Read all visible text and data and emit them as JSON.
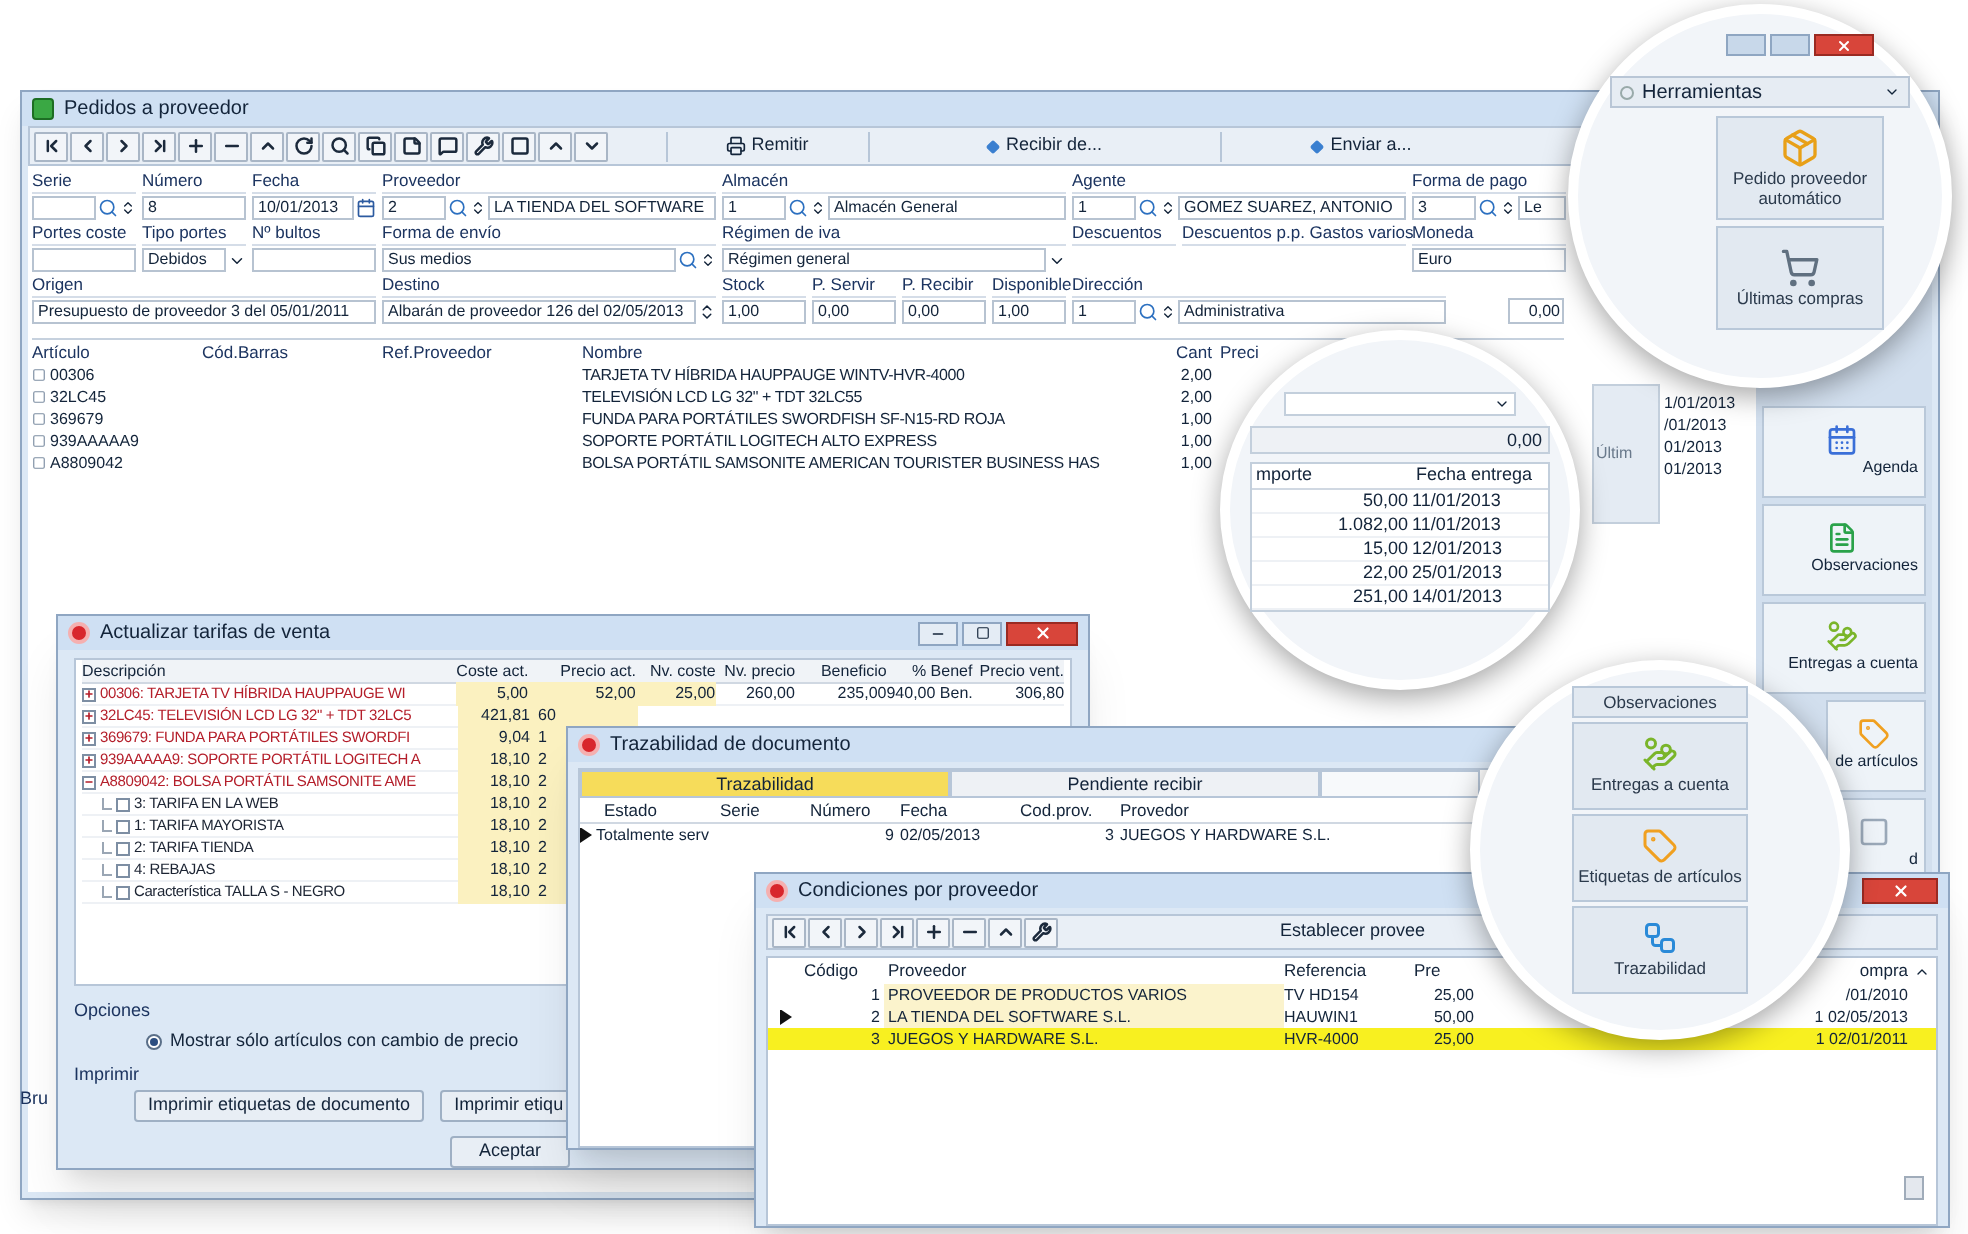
{
  "main_window": {
    "title": "Pedidos a proveedor",
    "actions": [
      {
        "label": "Remitir",
        "kind": "print"
      },
      {
        "label": "Recibir de...",
        "kind": "dropdown"
      },
      {
        "label": "Enviar a...",
        "kind": "dropdown"
      }
    ],
    "form_rows": [
      [
        {
          "label": "Serie",
          "kind": "lookup"
        },
        {
          "label": "Número",
          "value": "8",
          "kind": "text"
        },
        {
          "label": "Fecha",
          "value": "10/01/2013",
          "kind": "date"
        },
        {
          "label": "Proveedor",
          "value": "2",
          "detail": "LA TIENDA DEL SOFTWARE",
          "kind": "lookup"
        },
        {
          "label": "Almacén",
          "value": "1",
          "detail": "Almacén General",
          "kind": "lookup"
        },
        {
          "label": "Agente",
          "value": "1",
          "detail": "GOMEZ SUAREZ, ANTONIO",
          "kind": "lookup"
        },
        {
          "label": "Forma de pago",
          "value": "3",
          "detail": "Le",
          "kind": "lookup"
        }
      ],
      [
        {
          "label": "Portes coste",
          "kind": "text"
        },
        {
          "label": "Tipo portes",
          "value": "Debidos",
          "kind": "select"
        },
        {
          "label": "Nº bultos",
          "kind": "text"
        },
        {
          "label": "Forma de envío",
          "value": "Sus medios",
          "kind": "lookup"
        },
        {
          "label": "Régimen de iva",
          "value": "Régimen general",
          "kind": "select"
        },
        {
          "label": "Descuentos",
          "kind": "label"
        },
        {
          "label": "Descuentos p.p. Gastos varios",
          "kind": "label"
        },
        {
          "label": "Moneda",
          "value": "Euro",
          "kind": "text"
        }
      ],
      [
        {
          "label": "Origen",
          "value": "Presupuesto de proveedor 3 del 05/01/2011",
          "kind": "text"
        },
        {
          "label": "Destino",
          "value": "Albarán de proveedor 126 del 02/05/2013",
          "kind": "spin"
        },
        {
          "label": "Stock",
          "value": "1,00",
          "kind": "text"
        },
        {
          "label": "P. Servir",
          "value": "0,00",
          "kind": "text"
        },
        {
          "label": "P. Recibir",
          "value": "0,00",
          "kind": "text"
        },
        {
          "label": "Disponible",
          "value": "1,00",
          "kind": "text"
        },
        {
          "label": "Dirección",
          "value": "1",
          "detail": "Administrativa",
          "kind": "lookup"
        }
      ]
    ],
    "lines": {
      "columns": [
        "Artículo",
        "Cód.Barras",
        "Ref.Proveedor",
        "Nombre",
        "Cant",
        "Preci"
      ],
      "rows": [
        {
          "code": "00306",
          "name": "TARJETA TV HÍBRIDA HAUPPAUGE WINTV-HVR-4000",
          "qty": "2,00"
        },
        {
          "code": "32LC45",
          "name": "TELEVISIÓN LCD LG 32\" + TDT 32LC55",
          "qty": "2,00"
        },
        {
          "code": "369679",
          "name": "FUNDA PARA PORTÁTILES SWORDFISH SF-N15-RD ROJA",
          "qty": "1,00"
        },
        {
          "code": "939AAAAA9",
          "name": "SOPORTE PORTÁTIL LOGITECH ALTO EXPRESS",
          "qty": "1,00"
        },
        {
          "code": "A8809042",
          "name": "BOLSA PORTÁTIL SAMSONITE AMERICAN TOURISTER BUSINESS HAS",
          "qty": "1,00"
        }
      ]
    },
    "total": "0,00",
    "side_panel": {
      "button": "Últim",
      "dates": [
        "1/01/2013",
        "/01/2013",
        "01/2013",
        "01/2013"
      ]
    },
    "sidebar": [
      "Agenda",
      "Observaciones",
      "Entregas a cuenta",
      "de artículos",
      "d"
    ],
    "status_label": "Bru"
  },
  "magnifier_tools": {
    "dropdown": "Herramientas",
    "buttons": [
      "Pedido proveedor automático",
      "Últimas compras"
    ]
  },
  "magnifier_deliveries": {
    "total": "0,00",
    "columns": [
      "mporte",
      "Fecha entrega"
    ],
    "rows": [
      {
        "amount": "50,00",
        "date": "11/01/2013"
      },
      {
        "amount": "1.082,00",
        "date": "11/01/2013"
      },
      {
        "amount": "15,00",
        "date": "12/01/2013"
      },
      {
        "amount": "22,00",
        "date": "25/01/2013"
      },
      {
        "amount": "251,00",
        "date": "14/01/2013"
      }
    ]
  },
  "magnifier_sidebar": {
    "buttons": [
      "Observaciones",
      "Entregas a cuenta",
      "Etiquetas de artículos",
      "Trazabilidad"
    ]
  },
  "tariffs_dialog": {
    "title": "Actualizar tarifas de venta",
    "columns": [
      "Descripción",
      "Coste act.",
      "Precio act.",
      "Nv. coste",
      "Nv. precio",
      "Beneficio",
      "% Benef",
      "Precio vent."
    ],
    "rows": [
      {
        "desc": "00306: TARJETA TV HÍBRIDA HAUPPAUGE WI",
        "coste": "5,00",
        "precio": "52,00",
        "nv_coste": "25,00",
        "nv_precio": "260,00",
        "beneficio": "235,00",
        "pct": "940,00 Ben.",
        "venta": "306,80",
        "expanded": false
      },
      {
        "desc": "32LC45: TELEVISIÓN LCD LG 32\" + TDT 32LC5",
        "coste": "421,81",
        "precio": "60",
        "expanded": false
      },
      {
        "desc": "369679: FUNDA PARA PORTÁTILES SWORDFI",
        "coste": "9,04",
        "precio": "1",
        "expanded": false
      },
      {
        "desc": "939AAAAA9: SOPORTE PORTÁTIL LOGITECH A",
        "coste": "18,10",
        "precio": "2",
        "expanded": false
      },
      {
        "desc": "A8809042: BOLSA PORTÁTIL SAMSONITE AME",
        "coste": "18,10",
        "precio": "2",
        "expanded": true,
        "children": [
          {
            "desc": "3: TARIFA EN LA WEB",
            "coste": "18,10",
            "precio": "2",
            "checked": false
          },
          {
            "desc": "1: TARIFA MAYORISTA",
            "coste": "18,10",
            "precio": "2",
            "checked": false
          },
          {
            "desc": "2: TARIFA TIENDA",
            "coste": "18,10",
            "precio": "2",
            "checked": false
          },
          {
            "desc": "4: REBAJAS",
            "coste": "18,10",
            "precio": "2",
            "checked": false
          },
          {
            "desc": "Característica TALLA S - NEGRO",
            "coste": "18,10",
            "precio": "2",
            "checked": false
          }
        ]
      }
    ],
    "options_label": "Opciones",
    "option": {
      "label": "Mostrar sólo artículos con cambio de precio",
      "selected": true
    },
    "print_label": "Imprimir",
    "print_buttons": [
      "Imprimir etiquetas de documento",
      "Imprimir etiqu"
    ],
    "accept": "Aceptar"
  },
  "trace_dialog": {
    "title": "Trazabilidad de documento",
    "tabs": [
      {
        "label": "Trazabilidad",
        "selected": true
      },
      {
        "label": "Pendiente recibir",
        "selected": false
      }
    ],
    "columns": [
      "Estado",
      "Serie",
      "Número",
      "Fecha",
      "Cod.prov.",
      "Provedor"
    ],
    "rows": [
      {
        "estado": "Totalmente serv",
        "numero": "9",
        "fecha": "02/05/2013",
        "cod_prov": "3",
        "proveedor": "JUEGOS Y HARDWARE S.L.",
        "current": true
      }
    ]
  },
  "conditions_dialog": {
    "title": "Condiciones por proveedor",
    "toolbar_label": "Establecer provee",
    "columns": [
      "Código",
      "Proveedor",
      "Referencia",
      "Pre",
      "ompra"
    ],
    "rows": [
      {
        "codigo": "1",
        "proveedor": "PROVEEDOR DE PRODUCTOS VARIOS",
        "referencia": "TV HD154",
        "precio": "25,00",
        "fecha": "/01/2010",
        "current": false,
        "selected": false
      },
      {
        "codigo": "2",
        "proveedor": "LA TIENDA DEL SOFTWARE S.L.",
        "referencia": "HAUWIN1",
        "precio": "50,00",
        "fecha": "1 02/05/2013",
        "current": true,
        "selected": false
      },
      {
        "codigo": "3",
        "proveedor": "JUEGOS Y HARDWARE S.L.",
        "referencia": "HVR-4000",
        "precio": "25,00",
        "fecha": "1 02/01/2011",
        "current": false,
        "selected": true
      }
    ]
  }
}
